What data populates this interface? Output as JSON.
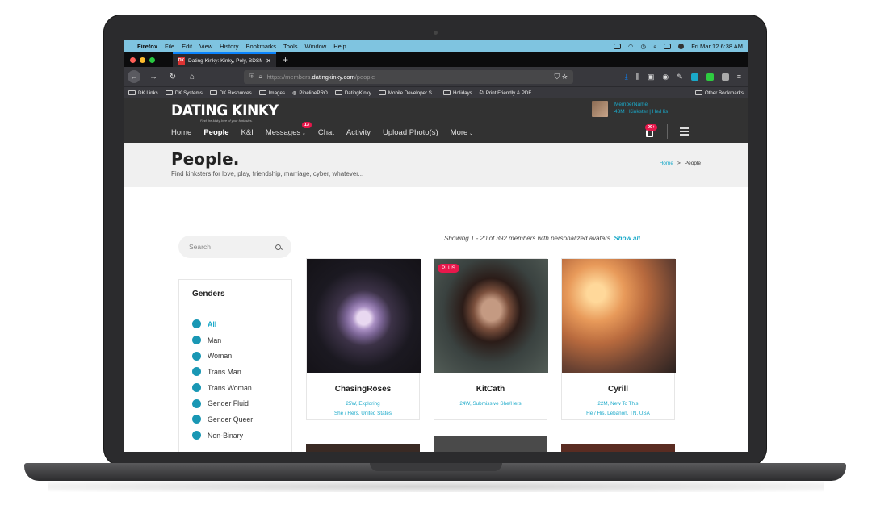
{
  "mac_menubar": {
    "apple": "",
    "app": "Firefox",
    "menus": [
      "File",
      "Edit",
      "View",
      "History",
      "Bookmarks",
      "Tools",
      "Window",
      "Help"
    ],
    "clock": "Fri Mar 12  6:38 AM"
  },
  "browser": {
    "tab_title": "Dating Kinky: Kinky, Poly, BDSM",
    "tab_favicon": "DK",
    "tab_close": "✕",
    "new_tab": "+",
    "url_scheme": "https://members.",
    "url_host": "datingkinky.com",
    "url_path": "/people",
    "page_actions": "··· ⛉ ☆"
  },
  "bookmarks": [
    "DK Links",
    "DK Systems",
    "DK Resources",
    "Images",
    "PipelinePRO",
    "DatingKinky",
    "Mobile Developer S...",
    "Holidays",
    "Print Friendly & PDF"
  ],
  "other_bookmarks": "Other Bookmarks",
  "site": {
    "logo": "DATING KINKY",
    "logo_tagline": "Find the kinky love of your fantasies.",
    "nav": [
      "Home",
      "People",
      "K&I",
      "Messages",
      "Chat",
      "Activity",
      "Upload Photo(s)",
      "More"
    ],
    "messages_badge": "13",
    "member_name": "MemberName",
    "member_info": "43M | Kinkster | He/His",
    "notif_badge": "99+"
  },
  "page": {
    "title": "People.",
    "subtitle": "Find kinksters for love, play, friendship, marriage, cyber, whatever...",
    "breadcrumb_home": "Home",
    "breadcrumb_sep": ">",
    "breadcrumb_current": "People"
  },
  "search": {
    "placeholder": "Search"
  },
  "results": {
    "showing": "Showing 1 - 20 of 392 members with personalized avatars.",
    "show_all": "Show all"
  },
  "genders": {
    "title": "Genders",
    "items": [
      "All",
      "Man",
      "Woman",
      "Trans Man",
      "Trans Woman",
      "Gender Fluid",
      "Gender Queer",
      "Non-Binary"
    ]
  },
  "members": [
    {
      "name": "ChasingRoses",
      "line1": "25W, Exploring",
      "line2": "She / Hers, United States",
      "badge": ""
    },
    {
      "name": "KitCath",
      "line1": "24W, Submissive She/Hers",
      "line2": "",
      "badge": "PLUS"
    },
    {
      "name": "Cyrill",
      "line1": "22M, New To This",
      "line2": "He / His, Lebanon, TN, USA",
      "badge": ""
    }
  ]
}
